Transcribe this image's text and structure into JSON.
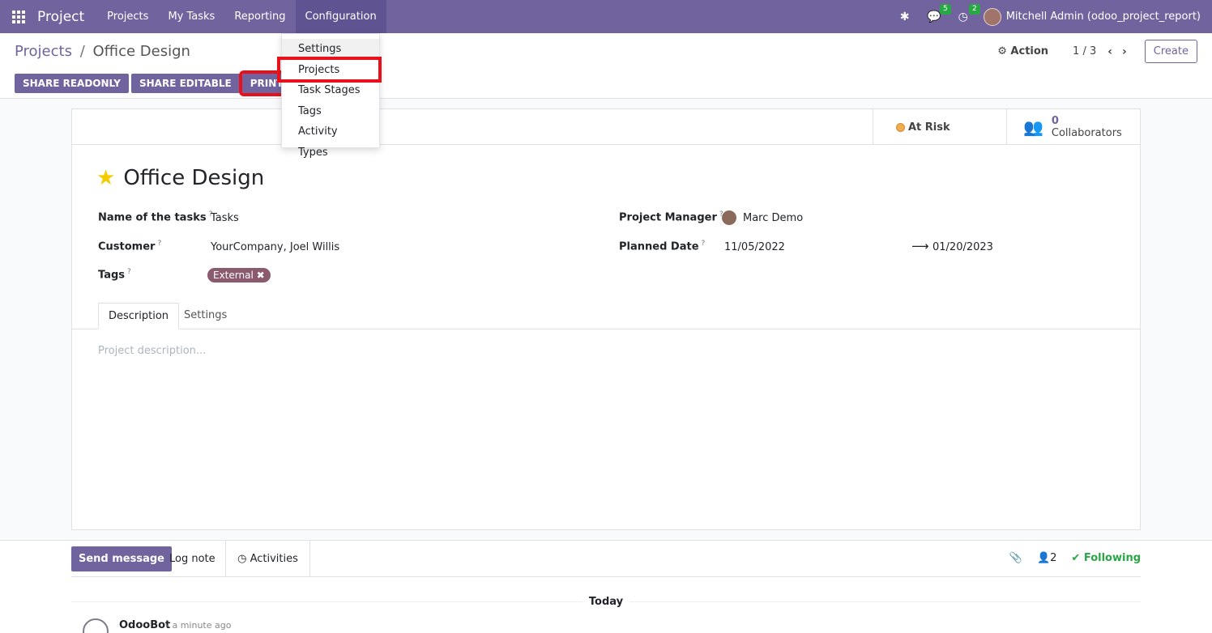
{
  "navbar": {
    "app_name": "Project",
    "menu": [
      "Projects",
      "My Tasks",
      "Reporting",
      "Configuration"
    ],
    "messages_badge": "5",
    "activities_badge": "2",
    "user": "Mitchell Admin (odoo_project_report)"
  },
  "dropdown": {
    "items": [
      "Settings",
      "Projects",
      "Task Stages",
      "Tags",
      "Activity Types"
    ]
  },
  "control_panel": {
    "breadcrumb_parent": "Projects",
    "breadcrumb_sep": "/",
    "breadcrumb_current": "Office Design",
    "action_label": "Action",
    "pager": "1 / 3",
    "create_label": "Create",
    "buttons": [
      "SHARE READONLY",
      "SHARE EDITABLE",
      "PRINT"
    ]
  },
  "stats": {
    "status_label": "At Risk",
    "collaborators_count": "0",
    "collaborators_label": "Collaborators"
  },
  "form": {
    "title": "Office Design",
    "fields": {
      "tasks_label": "Name of the tasks",
      "tasks_value": "Tasks",
      "customer_label": "Customer",
      "customer_value": "YourCompany, Joel Willis",
      "tags_label": "Tags",
      "tag_value": "External",
      "manager_label": "Project Manager",
      "manager_value": "Marc Demo",
      "planned_label": "Planned Date",
      "planned_start": "11/05/2022",
      "planned_end": "01/20/2023"
    },
    "help_mark": "?",
    "tabs": [
      "Description",
      "Settings"
    ],
    "description_placeholder": "Project description..."
  },
  "chatter": {
    "send_message": "Send message",
    "log_note": "Log note",
    "activities": "Activities",
    "followers_count": "2",
    "following": "Following",
    "today": "Today",
    "author": "OdooBot",
    "time": "- a minute ago"
  }
}
